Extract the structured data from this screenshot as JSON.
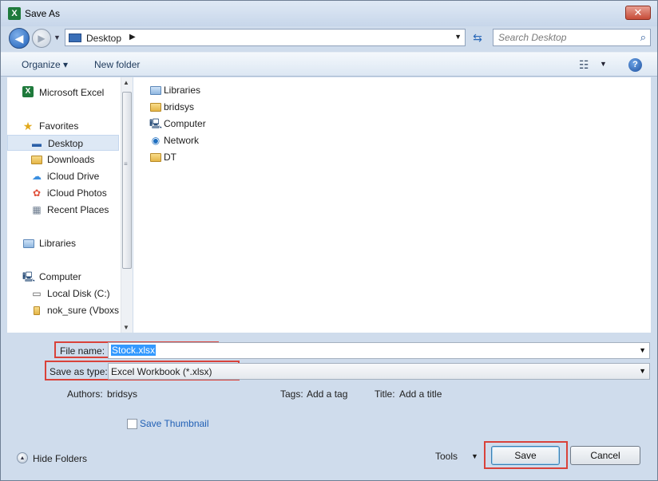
{
  "window": {
    "title": "Save As",
    "close_glyph": "✕"
  },
  "nav": {
    "back_glyph": "◀",
    "forward_glyph": "▶",
    "address": {
      "location": "Desktop",
      "separator": "▶",
      "dropdown": "▼"
    },
    "refresh_glyph": "⇆",
    "search": {
      "placeholder": "Search Desktop",
      "icon_glyph": "⌕"
    }
  },
  "toolbar": {
    "organize_label": "Organize ▾",
    "new_folder_label": "New folder",
    "view_glyph": "☷",
    "view_drop": "▼",
    "help_glyph": "?"
  },
  "sidebar": {
    "items": [
      {
        "label": "Microsoft Excel",
        "icon": "excel-icon",
        "glyph": "X"
      },
      {
        "label": "Favorites",
        "icon": "star-icon",
        "glyph": "★"
      },
      {
        "label": "Desktop",
        "icon": "desktop-icon",
        "glyph": "▬"
      },
      {
        "label": "Downloads",
        "icon": "downloads-folder-icon",
        "glyph": ""
      },
      {
        "label": "iCloud Drive",
        "icon": "icloud-icon",
        "glyph": "☁"
      },
      {
        "label": "iCloud Photos",
        "icon": "photos-icon",
        "glyph": "✿"
      },
      {
        "label": "Recent Places",
        "icon": "recent-places-icon",
        "glyph": "▦"
      },
      {
        "label": "Libraries",
        "icon": "libraries-icon",
        "glyph": ""
      },
      {
        "label": "Computer",
        "icon": "computer-icon",
        "glyph": "🖳"
      },
      {
        "label": "Local Disk (C:)",
        "icon": "disk-icon",
        "glyph": "▭"
      },
      {
        "label": "nok_sure (Vboxsv",
        "icon": "network-drive-icon",
        "glyph": ""
      }
    ]
  },
  "files": [
    {
      "label": "Libraries",
      "icon": "libraries-icon"
    },
    {
      "label": "bridsys",
      "icon": "user-folder-icon"
    },
    {
      "label": "Computer",
      "icon": "computer-icon",
      "glyph": "🖳"
    },
    {
      "label": "Network",
      "icon": "network-icon",
      "glyph": "◉"
    },
    {
      "label": "DT",
      "icon": "folder-icon"
    }
  ],
  "form": {
    "file_name_label": "File name:",
    "file_name_value": "Stock.xlsx",
    "save_type_label": "Save as type:",
    "save_type_value": "Excel Workbook (*.xlsx)",
    "dropdown_glyph": "▼",
    "authors_label": "Authors:",
    "authors_value": "bridsys",
    "tags_label": "Tags:",
    "tags_value": "Add a tag",
    "title_label": "Title:",
    "title_value": "Add a title",
    "thumbnail_label": "Save Thumbnail"
  },
  "footer": {
    "hide_folders_label": "Hide Folders",
    "hide_glyph": "▲",
    "tools_label": "Tools",
    "tools_drop": "▼",
    "save_label": "Save",
    "cancel_label": "Cancel"
  },
  "colors": {
    "highlight": "#d9423a",
    "link": "#2160b5",
    "selection": "#3399ff"
  }
}
